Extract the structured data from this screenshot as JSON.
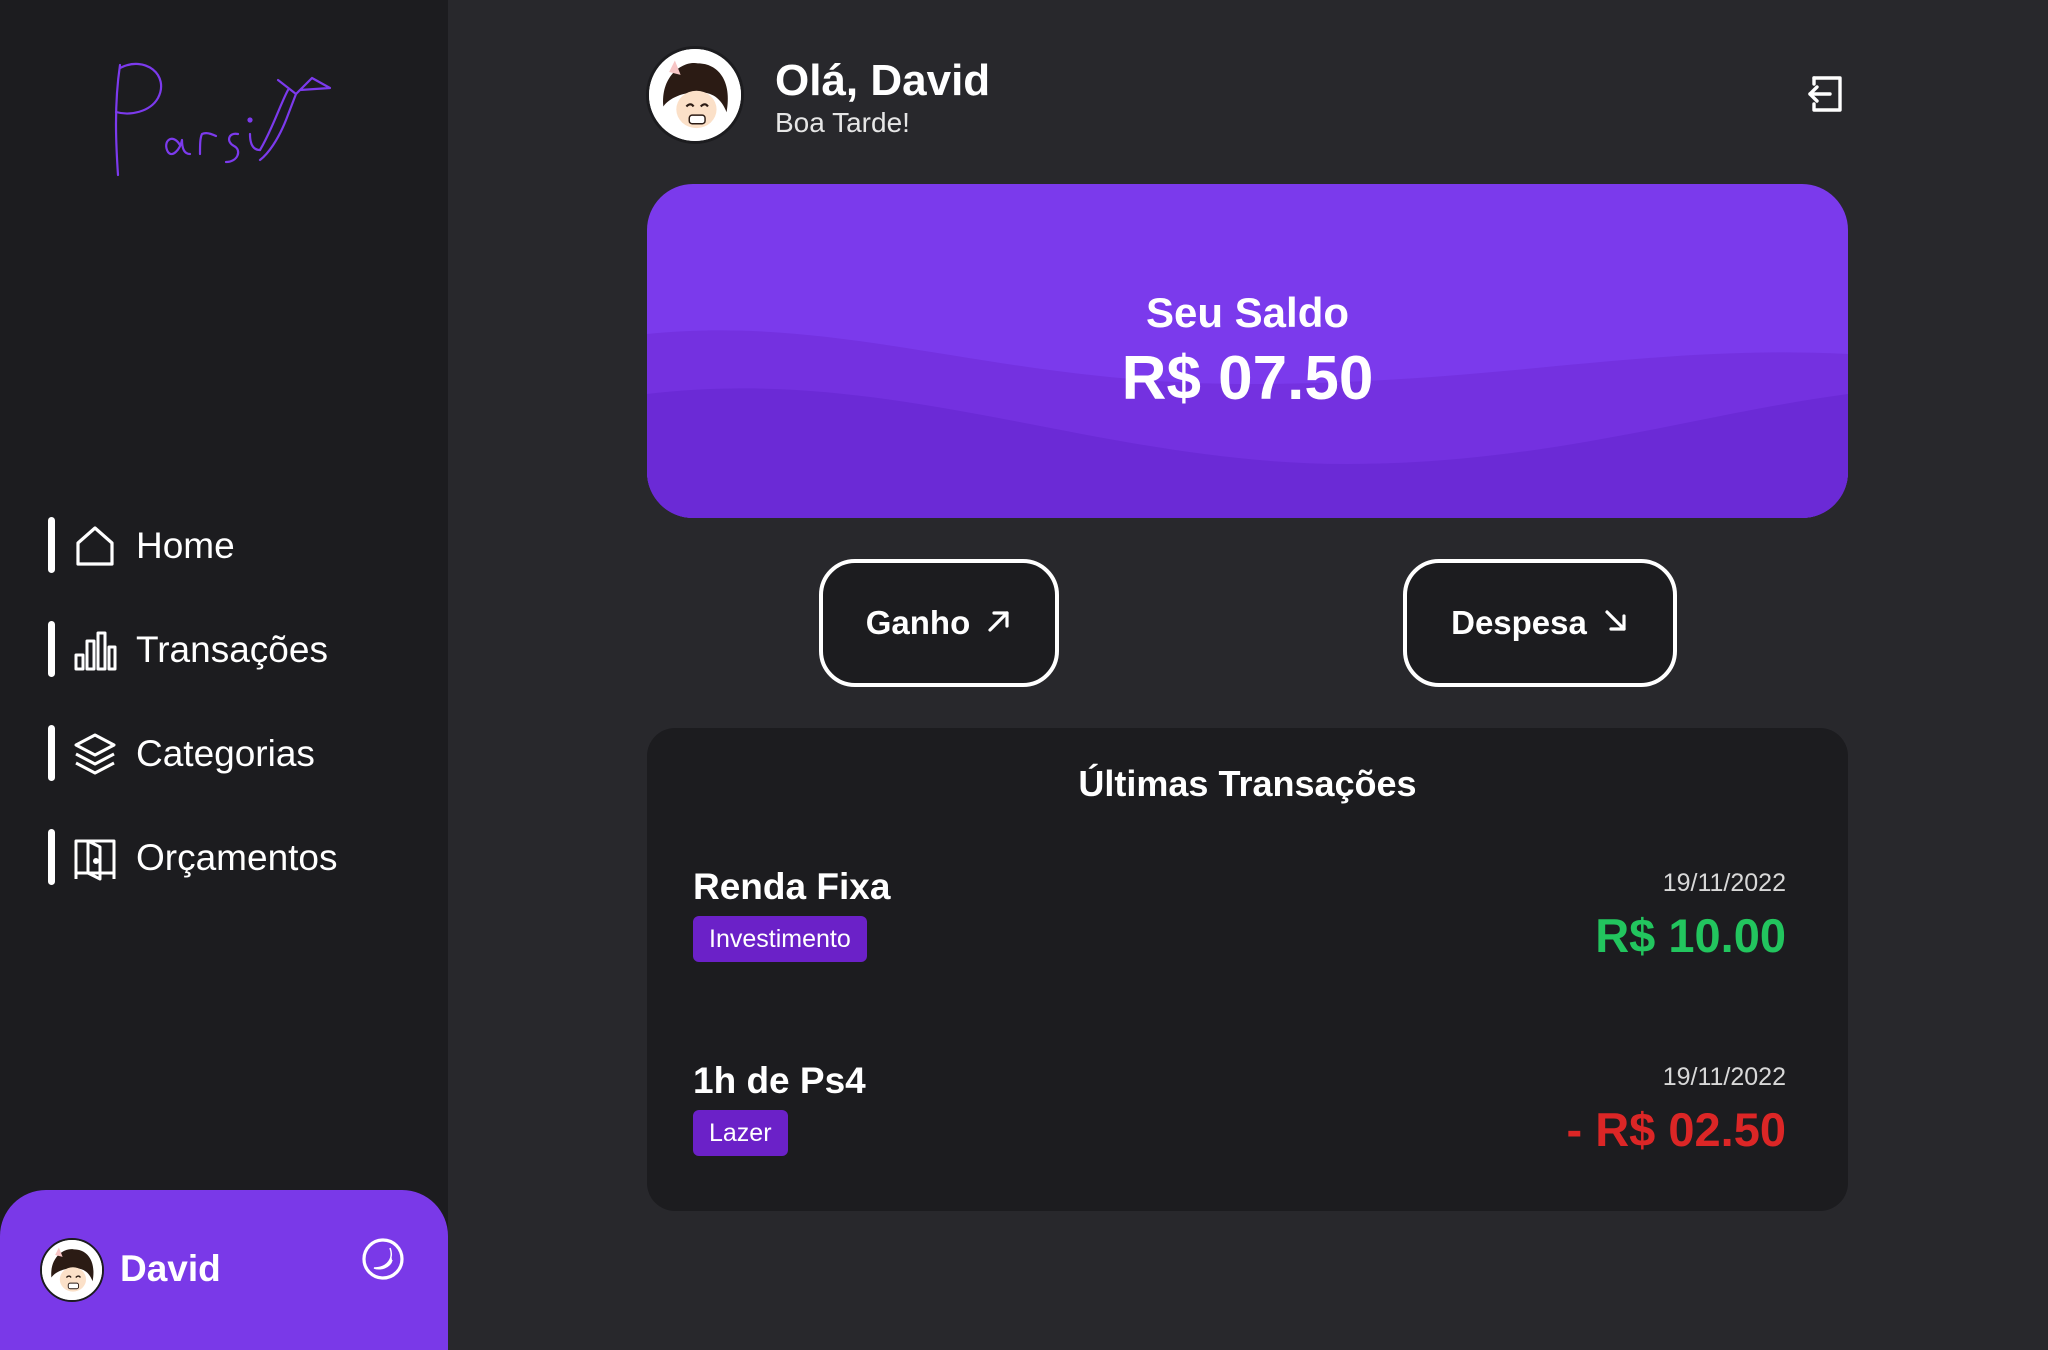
{
  "brand": {
    "logo_text": "Parsi",
    "accent_color": "#7a39e8"
  },
  "sidebar": {
    "items": [
      {
        "label": "Home",
        "icon": "home-icon"
      },
      {
        "label": "Transações",
        "icon": "bar-chart-icon"
      },
      {
        "label": "Categorias",
        "icon": "layers-icon"
      },
      {
        "label": "Orçamentos",
        "icon": "wallet-door-icon"
      }
    ],
    "profile": {
      "name": "David",
      "theme_icon": "moon-icon"
    }
  },
  "header": {
    "greeting": "Olá, David",
    "subgreeting": "Boa Tarde!",
    "logout_icon": "logout-icon"
  },
  "balance": {
    "label": "Seu Saldo",
    "value": "R$ 07.50"
  },
  "actions": {
    "income_label": "Ganho",
    "income_icon": "arrow-up-right-icon",
    "expense_label": "Despesa",
    "expense_icon": "arrow-down-right-icon"
  },
  "transactions": {
    "title": "Últimas Transações",
    "items": [
      {
        "name": "Renda Fixa",
        "category": "Investimento",
        "date": "19/11/2022",
        "amount": "R$ 10.00",
        "type": "income",
        "color": "#22c55e"
      },
      {
        "name": "1h de Ps4",
        "category": "Lazer",
        "date": "19/11/2022",
        "amount": "- R$ 02.50",
        "type": "expense",
        "color": "#dc2626"
      }
    ]
  }
}
